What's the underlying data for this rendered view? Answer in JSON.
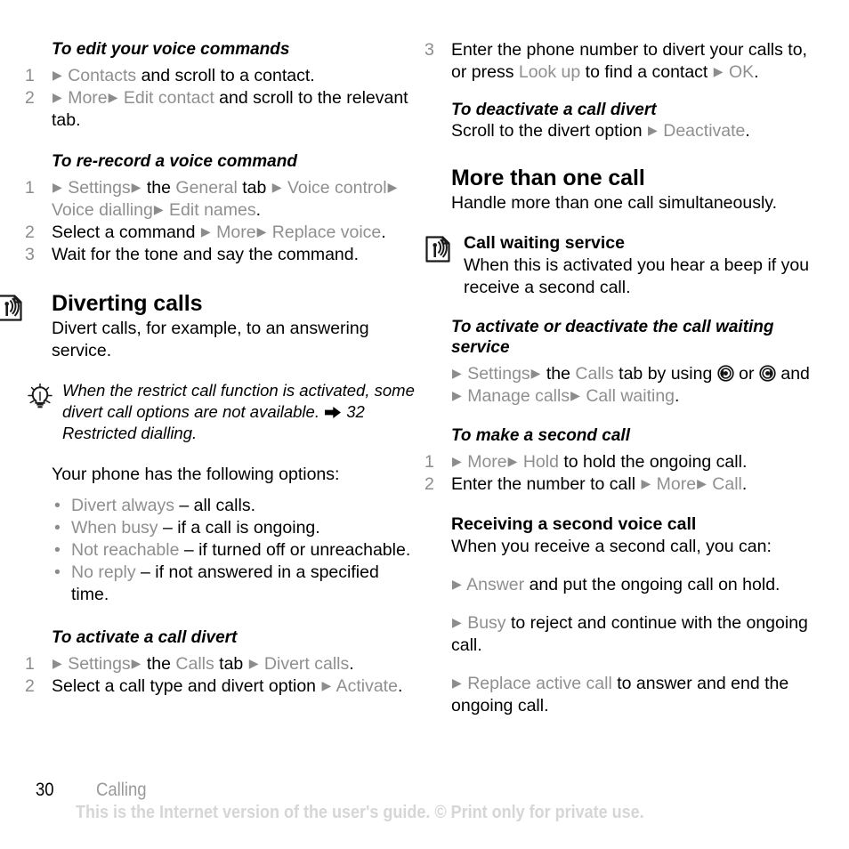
{
  "document": {
    "page_number": "30",
    "chapter": "Calling",
    "footer_note": "This is the Internet version of the user's guide. © Print only for private use."
  },
  "icons": {
    "service_icon": "network-service-icon",
    "tip_icon": "lightbulb-tip-icon",
    "xref_icon": "cross-reference-arrow-icon",
    "joystick_left": "joystick-left-icon",
    "joystick_right": "joystick-right-icon",
    "ui_arrow": "▶"
  },
  "colors": {
    "ui_term_gray": "#8f8f8f",
    "list_number_gray": "#8c8c8c",
    "body_black": "#000000",
    "footer_note_gray": "#d6d6d6",
    "footer_chapter_gray": "#9a9a9a"
  },
  "left_column": {
    "section_edit_voice": {
      "heading": "To edit your voice commands",
      "steps": [
        {
          "num": "1",
          "parts": [
            {
              "t": "arrow"
            },
            {
              "t": "ui",
              "v": "Contacts"
            },
            {
              "t": "text",
              "v": " and scroll to a contact."
            }
          ]
        },
        {
          "num": "2",
          "parts": [
            {
              "t": "arrow"
            },
            {
              "t": "ui",
              "v": "More"
            },
            {
              "t": "arrow"
            },
            {
              "t": "ui",
              "v": "Edit contact"
            },
            {
              "t": "text",
              "v": " and scroll to the relevant tab."
            }
          ]
        }
      ]
    },
    "section_rerecord": {
      "heading": "To re-record a voice command",
      "steps": [
        {
          "num": "1",
          "parts": [
            {
              "t": "arrow"
            },
            {
              "t": "ui",
              "v": "Settings"
            },
            {
              "t": "arrow"
            },
            {
              "t": "text",
              "v": " the "
            },
            {
              "t": "ui",
              "v": "General"
            },
            {
              "t": "text",
              "v": " tab "
            },
            {
              "t": "arrow"
            },
            {
              "t": "ui",
              "v": "Voice control"
            },
            {
              "t": "arrow"
            },
            {
              "t": "ui",
              "v": "Voice dialling"
            },
            {
              "t": "arrow"
            },
            {
              "t": "ui",
              "v": "Edit names"
            },
            {
              "t": "text",
              "v": "."
            }
          ]
        },
        {
          "num": "2",
          "parts": [
            {
              "t": "text",
              "v": "Select a command "
            },
            {
              "t": "arrow"
            },
            {
              "t": "ui",
              "v": "More"
            },
            {
              "t": "arrow"
            },
            {
              "t": "ui",
              "v": "Replace voice"
            },
            {
              "t": "text",
              "v": "."
            }
          ]
        },
        {
          "num": "3",
          "parts": [
            {
              "t": "text",
              "v": "Wait for the tone and say the command."
            }
          ]
        }
      ]
    },
    "section_diverting": {
      "heading": "Diverting calls",
      "body": "Divert calls, for example, to an answering service.",
      "tip": {
        "before": "When the restrict call function is activated, some divert call options are not available.",
        "after": "32 Restricted dialling."
      },
      "intro": "Your phone has the following options:",
      "options": [
        {
          "term": "Divert always",
          "desc": " – all calls."
        },
        {
          "term": "When busy",
          "desc": " – if a call is ongoing."
        },
        {
          "term": "Not reachable",
          "desc": " – if turned off or unreachable."
        },
        {
          "term": "No reply",
          "desc": " – if not answered in a specified time."
        }
      ]
    },
    "section_activate_divert": {
      "heading": "To activate a call divert",
      "steps": [
        {
          "num": "1",
          "parts": [
            {
              "t": "arrow"
            },
            {
              "t": "ui",
              "v": "Settings"
            },
            {
              "t": "arrow"
            },
            {
              "t": "text",
              "v": " the "
            },
            {
              "t": "ui",
              "v": "Calls"
            },
            {
              "t": "text",
              "v": " tab "
            },
            {
              "t": "arrow"
            },
            {
              "t": "ui",
              "v": "Divert calls"
            },
            {
              "t": "text",
              "v": "."
            }
          ]
        },
        {
          "num": "2",
          "parts": [
            {
              "t": "text",
              "v": "Select a call type and divert option "
            },
            {
              "t": "arrow"
            },
            {
              "t": "ui",
              "v": "Activate"
            },
            {
              "t": "text",
              "v": "."
            }
          ]
        }
      ]
    }
  },
  "right_column": {
    "step3_continued": {
      "num": "3",
      "parts": [
        {
          "t": "text",
          "v": "Enter the phone number to divert your calls to, or press "
        },
        {
          "t": "ui",
          "v": "Look up"
        },
        {
          "t": "text",
          "v": " to find a contact "
        },
        {
          "t": "arrow"
        },
        {
          "t": "ui",
          "v": "OK"
        },
        {
          "t": "text",
          "v": "."
        }
      ]
    },
    "section_deactivate_divert": {
      "heading": "To deactivate a call divert",
      "line_parts": [
        {
          "t": "text",
          "v": "Scroll to the divert option "
        },
        {
          "t": "arrow"
        },
        {
          "t": "ui",
          "v": "Deactivate"
        },
        {
          "t": "text",
          "v": "."
        }
      ]
    },
    "section_more_than_one": {
      "heading": "More than one call",
      "body": "Handle more than one call simultaneously."
    },
    "section_call_waiting": {
      "heading": "Call waiting service",
      "body": "When this is activated you hear a beep if you receive a second call."
    },
    "section_activate_waiting": {
      "heading": "To activate or deactivate the call waiting service",
      "line_parts": [
        {
          "t": "arrow"
        },
        {
          "t": "ui",
          "v": "Settings"
        },
        {
          "t": "arrow"
        },
        {
          "t": "text",
          "v": " the "
        },
        {
          "t": "ui",
          "v": "Calls"
        },
        {
          "t": "text",
          "v": " tab by using "
        },
        {
          "t": "joyleft"
        },
        {
          "t": "text",
          "v": " or "
        },
        {
          "t": "joyright"
        },
        {
          "t": "text",
          "v": " and "
        },
        {
          "t": "arrow"
        },
        {
          "t": "ui",
          "v": "Manage calls"
        },
        {
          "t": "arrow"
        },
        {
          "t": "ui",
          "v": "Call waiting"
        },
        {
          "t": "text",
          "v": "."
        }
      ]
    },
    "section_second_call": {
      "heading": "To make a second call",
      "steps": [
        {
          "num": "1",
          "parts": [
            {
              "t": "arrow"
            },
            {
              "t": "ui",
              "v": "More"
            },
            {
              "t": "arrow"
            },
            {
              "t": "ui",
              "v": "Hold"
            },
            {
              "t": "text",
              "v": " to hold the ongoing call."
            }
          ]
        },
        {
          "num": "2",
          "parts": [
            {
              "t": "text",
              "v": "Enter the number to call "
            },
            {
              "t": "arrow"
            },
            {
              "t": "ui",
              "v": "More"
            },
            {
              "t": "arrow"
            },
            {
              "t": "ui",
              "v": "Call"
            },
            {
              "t": "text",
              "v": "."
            }
          ]
        }
      ]
    },
    "section_receiving_second": {
      "heading": "Receiving a second voice call",
      "body": "When you receive a second call, you can:",
      "options": [
        {
          "parts": [
            {
              "t": "arrow"
            },
            {
              "t": "ui",
              "v": "Answer"
            },
            {
              "t": "text",
              "v": " and put the ongoing call on hold."
            }
          ]
        },
        {
          "parts": [
            {
              "t": "arrow"
            },
            {
              "t": "ui",
              "v": "Busy"
            },
            {
              "t": "text",
              "v": " to reject and continue with the ongoing call."
            }
          ]
        },
        {
          "parts": [
            {
              "t": "arrow"
            },
            {
              "t": "ui",
              "v": "Replace active call"
            },
            {
              "t": "text",
              "v": " to answer and end the ongoing call."
            }
          ]
        }
      ]
    }
  }
}
